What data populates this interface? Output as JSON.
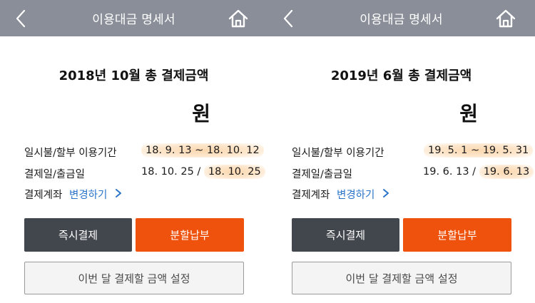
{
  "colors": {
    "header_bg": "#8a8e98",
    "link_blue": "#2a74c9",
    "dark_button": "#42464d",
    "orange_button": "#ee520c",
    "highlight": "#fbd8b0"
  },
  "panels": [
    {
      "header": {
        "title": "이용대금 명세서",
        "back_icon": "chevron-left-icon",
        "home_icon": "home-icon"
      },
      "statement_title": "2018년 10월 총 결제금액",
      "amount_unit": "원",
      "usage_period": {
        "label": "일시불/할부 이용기간",
        "value": "18. 9. 13 ~ 18. 10. 12"
      },
      "payment_dates": {
        "label": "결제일/출금일",
        "payment_date": "18. 10. 25",
        "separator": " / ",
        "withdrawal_date": "18. 10. 25"
      },
      "account": {
        "label": "결제계좌",
        "link": "변경하기"
      },
      "buttons": {
        "instant_pay": "즉시결제",
        "installment": "분할납부",
        "set_amount": "이번 달 결제할 금액 설정"
      }
    },
    {
      "header": {
        "title": "이용대금 명세서",
        "back_icon": "chevron-left-icon",
        "home_icon": "home-icon"
      },
      "statement_title": "2019년 6월 총 결제금액",
      "amount_unit": "원",
      "usage_period": {
        "label": "일시불/할부 이용기간",
        "value": "19. 5. 1 ~ 19. 5. 31"
      },
      "payment_dates": {
        "label": "결제일/출금일",
        "payment_date": "19. 6. 13",
        "separator": " / ",
        "withdrawal_date": "19. 6. 13"
      },
      "account": {
        "label": "결제계좌",
        "link": "변경하기"
      },
      "buttons": {
        "instant_pay": "즉시결제",
        "installment": "분할납부",
        "set_amount": "이번 달 결제할 금액 설정"
      }
    }
  ]
}
